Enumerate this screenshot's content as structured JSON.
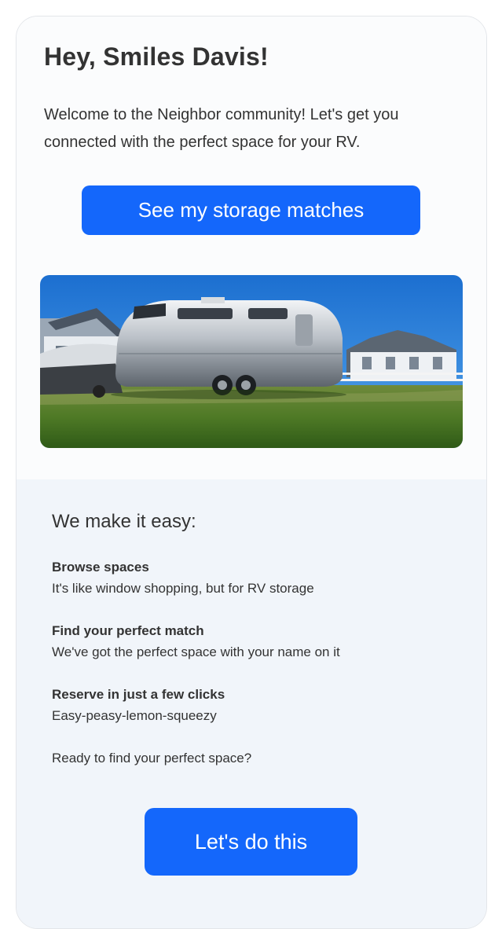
{
  "header": {
    "greeting": "Hey, Smiles Davis!",
    "welcome_text": "Welcome to the Neighbor community! Let's get you connected with the perfect space for your RV."
  },
  "primary_cta": {
    "label": "See my storage matches"
  },
  "hero_image": {
    "subject": "airstream-rv-trailer-photo"
  },
  "how_it_works": {
    "title": "We make it easy:",
    "features": [
      {
        "title": "Browse spaces",
        "description": "It's like window shopping, but for RV storage"
      },
      {
        "title": "Find your perfect match",
        "description": "We've got the perfect space with your name on it"
      },
      {
        "title": "Reserve in just a few clicks",
        "description": "Easy-peasy-lemon-squeezy"
      }
    ],
    "closing_prompt": "Ready to find your perfect space?"
  },
  "secondary_cta": {
    "label": "Let's do this"
  },
  "colors": {
    "accent": "#1467fb",
    "text": "#333333",
    "lower_panel": "#f1f5fa"
  }
}
